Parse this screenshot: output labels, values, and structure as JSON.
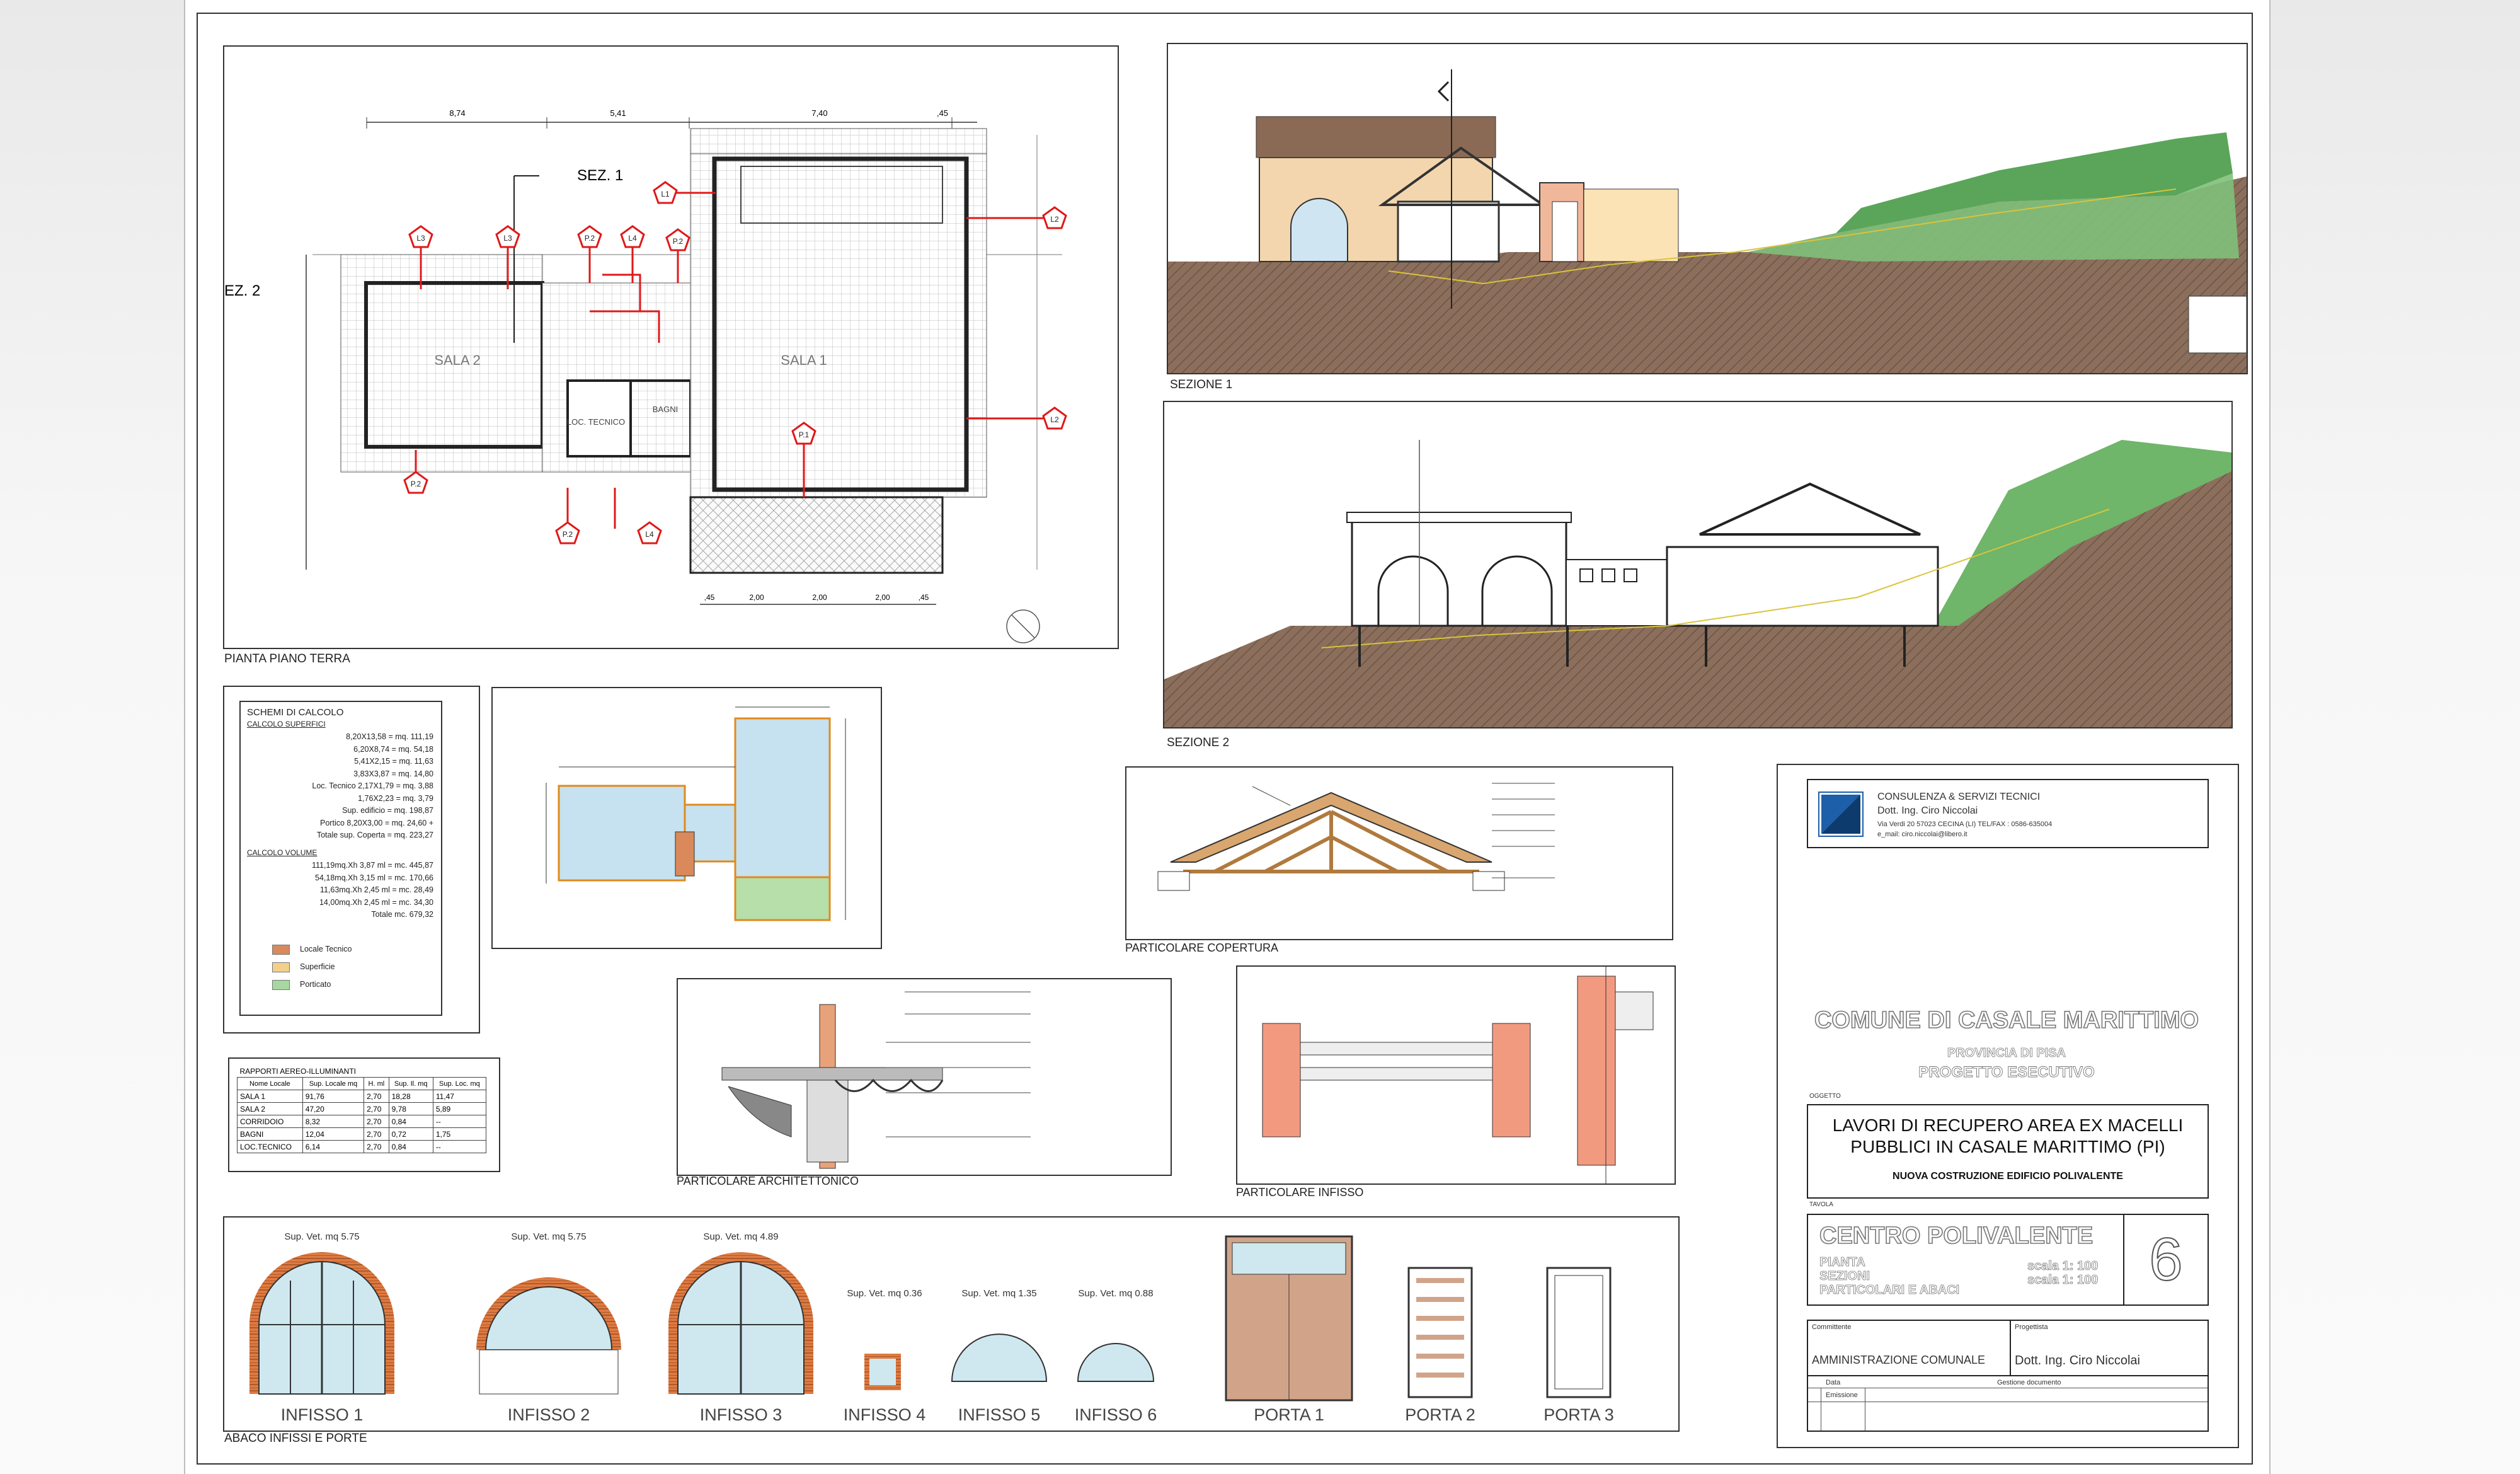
{
  "plan": {
    "caption": "PIANTA PIANO TERRA",
    "sez1": "SEZ. 1",
    "sez2": "EZ. 2",
    "rooms": [
      "SALA 2",
      "SALA 1",
      "LOC. TECNICO",
      "BAGNI"
    ],
    "tags": [
      "L3",
      "L3",
      "P.2",
      "L4",
      "P.2",
      "L1",
      "L2",
      "L2",
      "P.1",
      "P.2",
      "P.2",
      "L4"
    ],
    "top_dims": [
      "8,74",
      "5,41",
      "7,40",
      ",45"
    ],
    "bottom_dims": [
      ",45",
      "2,00",
      "2,00",
      "2,00",
      ",45"
    ]
  },
  "section1": {
    "caption": "SEZIONE 1"
  },
  "section2": {
    "caption": "SEZIONE 2"
  },
  "calc": {
    "title": "SCHEMI DI CALCOLO",
    "sub1": "CALCOLO SUPERFICI",
    "lines1": [
      "8,20X13,58 = mq. 111,19",
      "6,20X8,74 = mq. 54,18",
      "5,41X2,15 = mq. 11,63",
      "3,83X3,87 = mq. 14,80",
      "Loc. Tecnico   2,17X1,79 = mq. 3,88",
      "1,76X2,23 = mq. 3,79",
      "Sup. edificio   = mq. 198,87",
      "Portico   8,20X3,00 = mq. 24,60 +",
      "Totale sup. Coperta   = mq. 223,27"
    ],
    "sub2": "CALCOLO VOLUME",
    "lines2": [
      "111,19mq.Xh 3,87 ml = mc. 445,87",
      "54,18mq.Xh 3,15 ml = mc. 170,66",
      "11,63mq.Xh 2,45 ml = mc. 28,49",
      "14,00mq.Xh 2,45 ml = mc. 34,30",
      "Totale   mc. 679,32"
    ],
    "legend": [
      "Locale Tecnico",
      "Superficie",
      "Porticato"
    ],
    "legend_colors": [
      "#d9895a",
      "#f3d08a",
      "#a7d8a0"
    ]
  },
  "ratios": {
    "title": "RAPPORTI AEREO-ILLUMINANTI",
    "headers": [
      "Nome Locale",
      "Sup. Locale mq",
      "H. ml",
      "Sup. Il. mq",
      "Sup. Loc. mq"
    ],
    "rows": [
      [
        "SALA 1",
        "91,76",
        "2,70",
        "18,28",
        "11,47"
      ],
      [
        "SALA 2",
        "47,20",
        "2,70",
        "9,78",
        "5,89"
      ],
      [
        "CORRIDOIO",
        "8,32",
        "2,70",
        "0,84",
        "--"
      ],
      [
        "BAGNI",
        "12,04",
        "2,70",
        "0,72",
        "1,75"
      ],
      [
        "LOC.TECNICO",
        "6,14",
        "2,70",
        "0,84",
        "--"
      ]
    ]
  },
  "details": {
    "copertura": "PARTICOLARE COPERTURA",
    "architettonico": "PARTICOLARE ARCHITETTONICO",
    "infisso": "PARTICOLARE INFISSO"
  },
  "abaco": {
    "caption": "ABACO INFISSI E PORTE",
    "items": [
      {
        "label": "INFISSO 1",
        "sup": "Sup. Vet. mq 5.75"
      },
      {
        "label": "INFISSO 2",
        "sup": "Sup. Vet. mq 5.75"
      },
      {
        "label": "INFISSO 3",
        "sup": "Sup. Vet. mq 4.89"
      },
      {
        "label": "INFISSO 4",
        "sup": "Sup. Vet. mq 0.36"
      },
      {
        "label": "INFISSO 5",
        "sup": "Sup. Vet. mq 1.35"
      },
      {
        "label": "INFISSO 6",
        "sup": "Sup. Vet. mq 0.88"
      },
      {
        "label": "PORTA 1",
        "sup": ""
      },
      {
        "label": "PORTA 2",
        "sup": ""
      },
      {
        "label": "PORTA 3",
        "sup": ""
      }
    ]
  },
  "titleblock": {
    "firm": "CONSULENZA & SERVIZI TECNICI",
    "engineer": "Dott. Ing. Ciro Niccolai",
    "address": "Via Verdi 20 57023 CECINA (LI) TEL/FAX : 0586-635004",
    "email": "e_mail: ciro.niccolai@libero.it",
    "comune": "COMUNE DI CASALE MARITTIMO",
    "provincia": "PROVINCIA DI PISA",
    "progetto": "PROGETTO ESECUTIVO",
    "oggetto_label": "OGGETTO",
    "oggetto_1": "LAVORI DI RECUPERO AREA EX MACELLI",
    "oggetto_2": "PUBBLICI IN CASALE MARITTIMO (PI)",
    "oggetto_3": "NUOVA COSTRUZIONE EDIFICIO POLIVALENTE",
    "tavola_label": "TAVOLA",
    "tavola_title": "CENTRO POLIVALENTE",
    "tavola_items": [
      "PIANTA",
      "SEZIONI",
      "PARTICOLARI E ABACI"
    ],
    "scala": [
      "scala 1: 100",
      "scala 1: 100"
    ],
    "tavola_num": "6",
    "committente_label": "Committente",
    "committente": "AMMINISTRAZIONE COMUNALE",
    "progettista_label": "Progettista",
    "progettista": "Dott. Ing. Ciro Niccolai",
    "data_label": "Data",
    "gestione": "Gestione documento",
    "emissione": "Emissione"
  }
}
